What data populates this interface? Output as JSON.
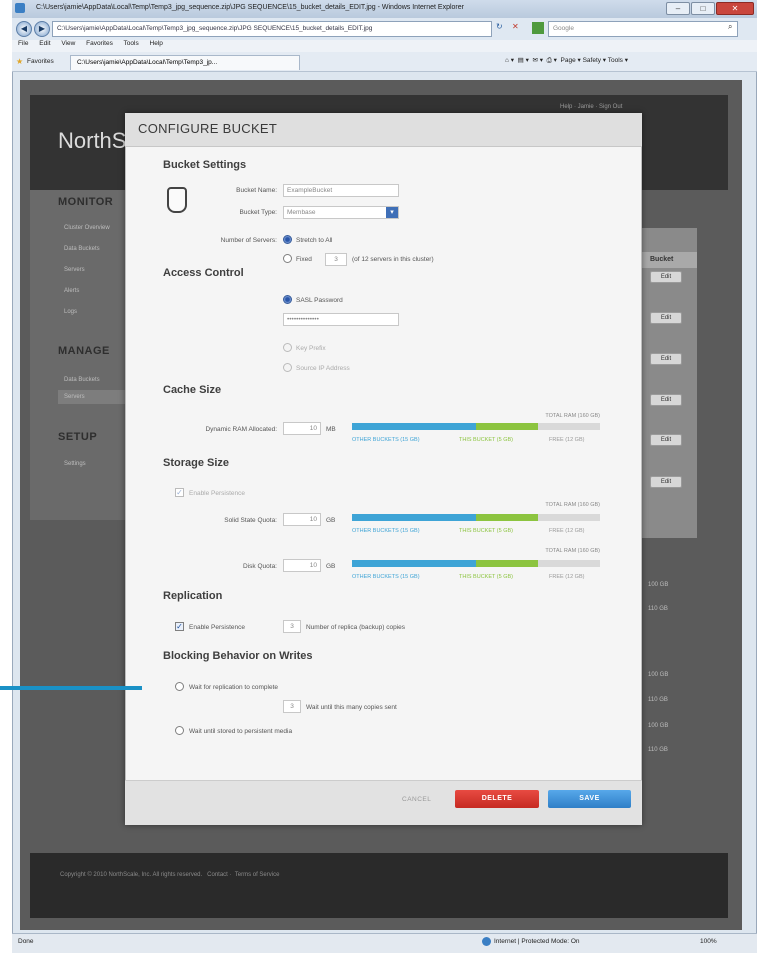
{
  "browser": {
    "title": "C:\\Users\\jamie\\AppData\\Local\\Temp\\Temp3_jpg_sequence.zip\\JPG SEQUENCE\\15_bucket_details_EDIT.jpg - Windows Internet Explorer",
    "address": "C:\\Users\\jamie\\AppData\\Local\\Temp\\Temp3_jpg_sequence.zip\\JPG SEQUENCE\\15_bucket_details_EDIT.jpg",
    "search_placeholder": "Google",
    "menu": [
      "File",
      "Edit",
      "View",
      "Favorites",
      "Tools",
      "Help"
    ],
    "favorites_label": "Favorites",
    "tab_label": "C:\\Users\\jamie\\AppData\\Local\\Temp\\Temp3_jp...",
    "commands": "Page ▾   Safety ▾   Tools ▾",
    "status_left": "Done",
    "status_zone": "Internet | Protected Mode: On",
    "zoom": "100%"
  },
  "site": {
    "logo": "NorthS",
    "toplinks": "Help  ·  Jamie  ·  Sign Out",
    "nav": {
      "monitor": {
        "title": "MONITOR",
        "items": [
          "Cluster Overview",
          "Data Buckets",
          "Servers",
          "Alerts",
          "Logs"
        ]
      },
      "manage": {
        "title": "MANAGE",
        "items": [
          "Data Buckets",
          "Servers"
        ]
      },
      "setup": {
        "title": "SETUP",
        "items": [
          "Settings"
        ]
      }
    },
    "right_header": "Bucket",
    "edit_label": "Edit",
    "right_values": [
      "100 GB",
      "110 GB",
      "100 GB",
      "110 GB",
      "100 GB",
      "110 GB"
    ],
    "footer": {
      "copyright": "Copyright © 2010 NorthScale, Inc. All rights reserved.",
      "contact": "Contact",
      "terms": "Terms of Service"
    }
  },
  "modal": {
    "title": "CONFIGURE BUCKET",
    "bucket_settings": {
      "heading": "Bucket Settings",
      "name_label": "Bucket Name:",
      "name_value": "ExampleBucket",
      "type_label": "Bucket Type:",
      "type_value": "Membase",
      "servers_label": "Number of Servers:",
      "stretch_label": "Stretch to All",
      "fixed_label": "Fixed",
      "fixed_value": "3",
      "fixed_note": "(of 12 servers in this cluster)"
    },
    "access_control": {
      "heading": "Access Control",
      "sasl_label": "SASL Password",
      "password_value": "••••••••••••••",
      "key_prefix_label": "Key Prefix",
      "source_ip_label": "Source IP Address"
    },
    "cache_size": {
      "heading": "Cache Size",
      "ram_label": "Dynamic RAM Allocated:",
      "ram_value": "10",
      "ram_unit": "MB",
      "total": "TOTAL RAM (160 GB)",
      "other": "OTHER BUCKETS (15 GB)",
      "this": "THIS BUCKET (5 GB)",
      "free": "FREE (12 GB)",
      "fractions": {
        "other": 0.5,
        "this": 0.25
      }
    },
    "storage_size": {
      "heading": "Storage Size",
      "enable_label": "Enable Persistence",
      "ssd_label": "Solid State Quota:",
      "ssd_value": "10",
      "disk_label": "Disk Quota:",
      "disk_value": "10",
      "unit": "GB",
      "total": "TOTAL RAM (160 GB)",
      "other": "OTHER BUCKETS (15 GB)",
      "this": "THIS BUCKET (5 GB)",
      "free": "FREE (12 GB)"
    },
    "replication": {
      "heading": "Replication",
      "enable_label": "Enable Persistence",
      "replica_value": "3",
      "replica_label": "Number of replica (backup) copies"
    },
    "blocking": {
      "heading": "Blocking Behavior on Writes",
      "opt1": "Wait for replication to complete",
      "copies_value": "3",
      "copies_label": "Wait until this many copies sent",
      "opt2": "Wait until stored to persistent media"
    },
    "buttons": {
      "cancel": "CANCEL",
      "delete": "DELETE",
      "save": "SAVE"
    }
  },
  "colors": {
    "accent_blue": "#3ea4d6",
    "accent_green": "#8cc43f",
    "delete": "#d9332b",
    "save": "#3c8fd6",
    "pointer": "#1a91c6"
  }
}
